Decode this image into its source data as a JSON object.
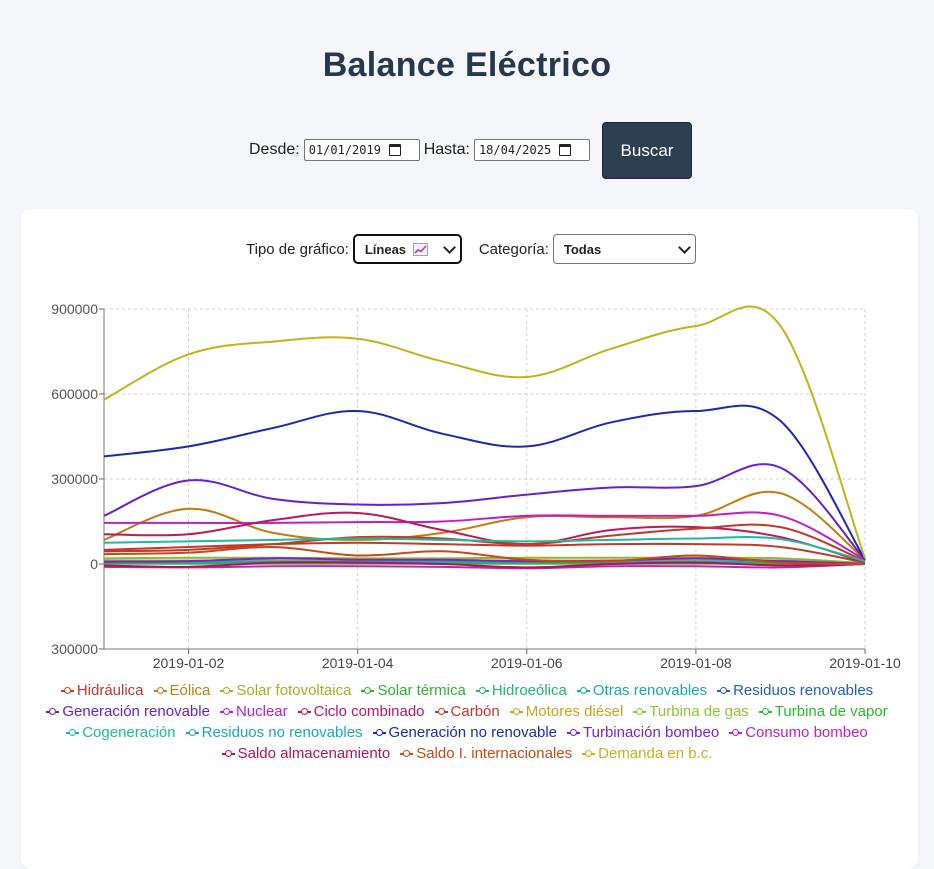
{
  "page": {
    "title": "Balance Eléctrico"
  },
  "filters": {
    "desde_label": "Desde:",
    "desde_value": "01/01/2019",
    "hasta_label": "Hasta:",
    "hasta_value": "18/04/2025",
    "search_label": "Buscar"
  },
  "controls": {
    "chart_type_label": "Tipo de gráfico:",
    "chart_type_value": "Líneas",
    "chart_type_icon": "chart-increasing-icon",
    "category_label": "Categoría:",
    "category_value": "Todas"
  },
  "chart_data": {
    "type": "line",
    "x": [
      "2019-01-01",
      "2019-01-02",
      "2019-01-03",
      "2019-01-04",
      "2019-01-05",
      "2019-01-06",
      "2019-01-07",
      "2019-01-08",
      "2019-01-09",
      "2019-01-10"
    ],
    "xtick_labels": [
      "2019-01-02",
      "2019-01-04",
      "2019-01-06",
      "2019-01-08",
      "2019-01-10"
    ],
    "ytick_labels": [
      "900000",
      "600000",
      "300000",
      "0",
      "300000"
    ],
    "ylim": [
      -300000,
      900000
    ],
    "grid": true,
    "legend_position": "bottom",
    "series": [
      {
        "name": "Hidráulica",
        "color": "#c0392b",
        "values": [
          50000,
          60000,
          70000,
          75000,
          70000,
          65000,
          70000,
          70000,
          60000,
          5000
        ]
      },
      {
        "name": "Eólica",
        "color": "#c57a12",
        "values": [
          85000,
          195000,
          110000,
          85000,
          110000,
          165000,
          165000,
          170000,
          250000,
          15000
        ]
      },
      {
        "name": "Solar fotovoltaica",
        "color": "#9ab423",
        "values": [
          20000,
          22000,
          22000,
          20000,
          20000,
          22000,
          22000,
          22000,
          20000,
          3000
        ]
      },
      {
        "name": "Solar térmica",
        "color": "#2db42d",
        "values": [
          5000,
          5000,
          5000,
          5000,
          5000,
          5000,
          5000,
          5000,
          5000,
          1000
        ]
      },
      {
        "name": "Hidroeólica",
        "color": "#22b573",
        "values": [
          1000,
          1000,
          1000,
          1000,
          1000,
          1000,
          1000,
          1000,
          1000,
          500
        ]
      },
      {
        "name": "Otras renovables",
        "color": "#17a8b1",
        "values": [
          12000,
          12000,
          12000,
          12000,
          12000,
          12000,
          12000,
          12000,
          12000,
          2000
        ]
      },
      {
        "name": "Residuos renovables",
        "color": "#1f5fbf",
        "values": [
          3000,
          3000,
          3000,
          3000,
          3000,
          3000,
          3000,
          3000,
          3000,
          500
        ]
      },
      {
        "name": "Generación renovable",
        "color": "#6a1fc9",
        "values": [
          170000,
          295000,
          230000,
          210000,
          215000,
          245000,
          270000,
          275000,
          340000,
          15000
        ]
      },
      {
        "name": "Nuclear",
        "color": "#c21fc1",
        "values": [
          145000,
          145000,
          145000,
          148000,
          150000,
          170000,
          170000,
          170000,
          170000,
          15000
        ]
      },
      {
        "name": "Ciclo combinado",
        "color": "#c0185a",
        "values": [
          105000,
          105000,
          155000,
          180000,
          120000,
          70000,
          120000,
          130000,
          95000,
          5000
        ]
      },
      {
        "name": "Carbón",
        "color": "#c0392b",
        "values": [
          45000,
          50000,
          70000,
          95000,
          90000,
          70000,
          100000,
          125000,
          130000,
          10000
        ]
      },
      {
        "name": "Motores diésel",
        "color": "#c7a41a",
        "values": [
          10000,
          10000,
          10000,
          10000,
          10000,
          10000,
          10000,
          10000,
          10000,
          2000
        ]
      },
      {
        "name": "Turbina de gas",
        "color": "#8bc832",
        "values": [
          2000,
          2000,
          2000,
          2000,
          2000,
          2000,
          2000,
          2000,
          2000,
          500
        ]
      },
      {
        "name": "Turbina de vapor",
        "color": "#2abb2a",
        "values": [
          3000,
          3000,
          3000,
          3000,
          3000,
          3000,
          3000,
          3000,
          3000,
          500
        ]
      },
      {
        "name": "Cogeneración",
        "color": "#1abc9c",
        "values": [
          75000,
          80000,
          85000,
          90000,
          85000,
          80000,
          85000,
          90000,
          88000,
          10000
        ]
      },
      {
        "name": "Residuos no renovables",
        "color": "#1aa7b8",
        "values": [
          8000,
          8000,
          8000,
          8000,
          8000,
          8000,
          8000,
          8000,
          8000,
          1000
        ]
      },
      {
        "name": "Generación no renovable",
        "color": "#1c2ab0",
        "values": [
          380000,
          415000,
          480000,
          540000,
          460000,
          415000,
          500000,
          540000,
          505000,
          15000
        ]
      },
      {
        "name": "Turbinación bombeo",
        "color": "#7d22c9",
        "values": [
          8000,
          10000,
          20000,
          15000,
          15000,
          10000,
          12000,
          20000,
          10000,
          1000
        ]
      },
      {
        "name": "Consumo bombeo",
        "color": "#c21fc1",
        "values": [
          -10000,
          -12000,
          -8000,
          -8000,
          -10000,
          -15000,
          -8000,
          -8000,
          -12000,
          0
        ]
      },
      {
        "name": "Saldo almacenamiento",
        "color": "#b01454",
        "values": [
          -5000,
          -10000,
          5000,
          5000,
          0,
          -12000,
          0,
          5000,
          -5000,
          0
        ]
      },
      {
        "name": "Saldo I. internacionales",
        "color": "#c54a12",
        "values": [
          35000,
          40000,
          60000,
          30000,
          45000,
          15000,
          10000,
          30000,
          5000,
          0
        ]
      },
      {
        "name": "Demanda en b.c.",
        "color": "#c3b21a",
        "values": [
          580000,
          740000,
          785000,
          795000,
          715000,
          660000,
          760000,
          840000,
          840000,
          20000
        ]
      }
    ]
  }
}
